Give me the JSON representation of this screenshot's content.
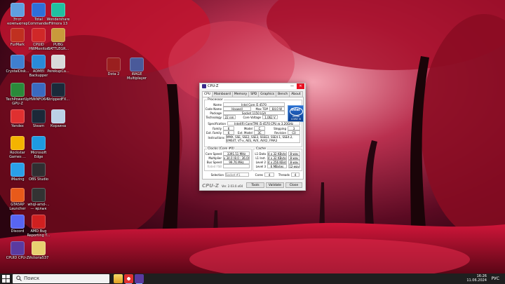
{
  "desktop": {
    "icons": [
      {
        "label": "Этот компьютер",
        "color": "#5fa0e0"
      },
      {
        "label": "Total Commander",
        "color": "#2e6fd8"
      },
      {
        "label": "Wondershare Filmora 13",
        "color": "#20c0a0"
      },
      {
        "label": "FurMark",
        "color": "#c03020"
      },
      {
        "label": "CPUID HWMonitor",
        "color": "#d02828"
      },
      {
        "label": "PUBG BATTLEGR...",
        "color": "#c99a3b"
      },
      {
        "label": "CrystalDisk...",
        "color": "#3f7fd0"
      },
      {
        "label": "ADMEI Backupper",
        "color": "#2a8ad8"
      },
      {
        "label": "PerekupCa...",
        "color": "#d9d9d9"
      },
      {
        "label": "Dota 2",
        "color": "#9a1f1f"
      },
      {
        "label": "iRAGE Multiplayer",
        "color": "#4a5a9a"
      },
      {
        "label": "TechPowerUp GPU-Z",
        "color": "#2a8a3a"
      },
      {
        "label": "HWiNFO64",
        "color": "#3a6ac0"
      },
      {
        "label": "StrippedFX...",
        "color": "#1a2a3a"
      },
      {
        "label": "Yandex",
        "color": "#e03030"
      },
      {
        "label": "Steam",
        "color": "#1b2838"
      },
      {
        "label": "Корзина",
        "color": "#bcd0e6"
      },
      {
        "label": "Rockstar Games ...",
        "color": "#f4b400"
      },
      {
        "label": "Microsoft Edge",
        "color": "#1e9be0"
      },
      {
        "label": "iMazing",
        "color": "#2aa0e8"
      },
      {
        "label": "OBS Studio",
        "color": "#302e31"
      },
      {
        "label": "GTA5RP Launcher",
        "color": "#e85a1a"
      },
      {
        "label": "whql-amd-... — ярлык",
        "color": "#333333"
      },
      {
        "label": "Discord",
        "color": "#5865f2"
      },
      {
        "label": "AMD Bug Reporting T...",
        "color": "#d02020"
      },
      {
        "label": "CPUID CPU-Z",
        "color": "#5a3aa0"
      },
      {
        "label": "Victoria537",
        "color": "#e8d070"
      }
    ]
  },
  "window": {
    "title": "CPU-Z",
    "controls": {
      "minimize": "—",
      "close": "✕"
    },
    "tabs": [
      "CPU",
      "Mainboard",
      "Memory",
      "SPD",
      "Graphics",
      "Bench",
      "About"
    ],
    "processor": {
      "group": "Processor",
      "name_label": "Name",
      "name": "Intel Core i5 4570",
      "codename_label": "Code Name",
      "codename": "Haswell",
      "maxtdp_label": "Max TDP",
      "maxtdp": "84.0 W",
      "package_label": "Package",
      "package": "Socket 1150 LGA",
      "technology_label": "Technology",
      "technology": "22 nm",
      "corevoltage_label": "Core Voltage",
      "corevoltage": "1.062 V",
      "spec_label": "Specification",
      "spec": "Intel(R) Core(TM) i5-4570 CPU @ 3.20GHz",
      "family_label": "Family",
      "family": "6",
      "model_label": "Model",
      "model": "C",
      "stepping_label": "Stepping",
      "stepping": "3",
      "extfamily_label": "Ext. Family",
      "extfamily": "6",
      "extmodel_label": "Ext. Model",
      "extmodel": "3C",
      "revision_label": "Revision",
      "revision": "C0",
      "instructions_label": "Instructions",
      "instructions": "MMX, SSE, SSE2, SSE3, SSSE3, SSE4.1, SSE4.2, EM64T, VT-x, AES, AVX, AVX2, FMA3"
    },
    "intel_logo": {
      "brand": "intel",
      "line1": "inside",
      "line2": "CORE i5"
    },
    "clocks": {
      "group": "Clocks (Core #0)",
      "corespeed_label": "Core Speed",
      "corespeed": "3391.51 MHz",
      "multiplier_label": "Multiplier",
      "multiplier": "x 34.0 (8.0 - 36.0)",
      "busspeed_label": "Bus Speed",
      "busspeed": "99.76 MHz",
      "ratedfsb_label": "Rated FSB",
      "ratedfsb": ""
    },
    "cache": {
      "group": "Cache",
      "rows": [
        {
          "label": "L1 Data",
          "size": "4 x 32 KBytes",
          "way": "8-way"
        },
        {
          "label": "L1 Inst.",
          "size": "4 x 32 KBytes",
          "way": "8-way"
        },
        {
          "label": "Level 2",
          "size": "4 x 256 KBytes",
          "way": "8-way"
        },
        {
          "label": "Level 3",
          "size": "6 MBytes",
          "way": "12-way"
        }
      ]
    },
    "selection": {
      "label": "Selection",
      "value": "Socket #1",
      "cores_label": "Cores",
      "cores": "4",
      "threads_label": "Threads",
      "threads": "4"
    },
    "footer": {
      "logo": "CPU-Z",
      "version": "Ver. 2.03.0.x64",
      "tools": "Tools",
      "validate": "Validate",
      "close": "Close"
    }
  },
  "taskbar": {
    "search_placeholder": "Поиск",
    "time": "16:26",
    "date": "11.06.2024",
    "lang": "РУС"
  },
  "colors": {
    "taskbar": "#1f1f1f",
    "wallpaper_red": "#c8102e",
    "accent_blue": "#0b3e8f"
  }
}
